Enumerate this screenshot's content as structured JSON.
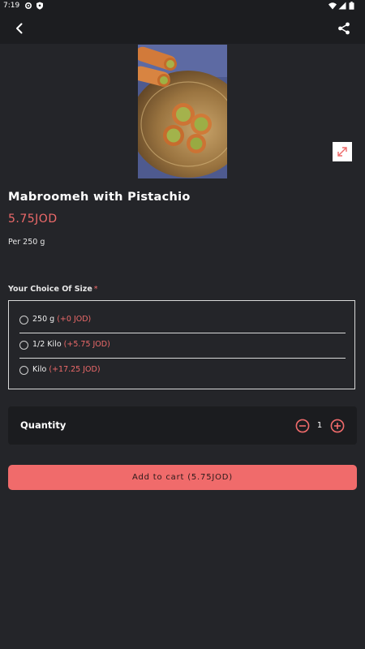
{
  "status_bar": {
    "time": "7:19"
  },
  "product": {
    "name": "Mabroomeh with Pistachio",
    "price": "5.75JOD",
    "unit": "Per 250 g"
  },
  "size_section": {
    "label": "Your Choice Of Size",
    "required_mark": "*",
    "options": [
      {
        "name": "250 g",
        "extra": "(+0 JOD)",
        "selected": false
      },
      {
        "name": "1/2 Kilo",
        "extra": "(+5.75 JOD)",
        "selected": false
      },
      {
        "name": "Kilo",
        "extra": "(+17.25 JOD)",
        "selected": false
      }
    ]
  },
  "quantity": {
    "label": "Quantity",
    "value": "1"
  },
  "cart_button": {
    "label": "Add to cart (5.75JOD)"
  },
  "icons": {
    "back": "back-arrow-icon",
    "share": "share-icon",
    "expand": "expand-icon",
    "minus": "minus-circle-icon",
    "plus": "plus-circle-icon"
  },
  "colors": {
    "accent": "#f06b6b",
    "background": "#242529",
    "card": "#1b1c1f"
  }
}
